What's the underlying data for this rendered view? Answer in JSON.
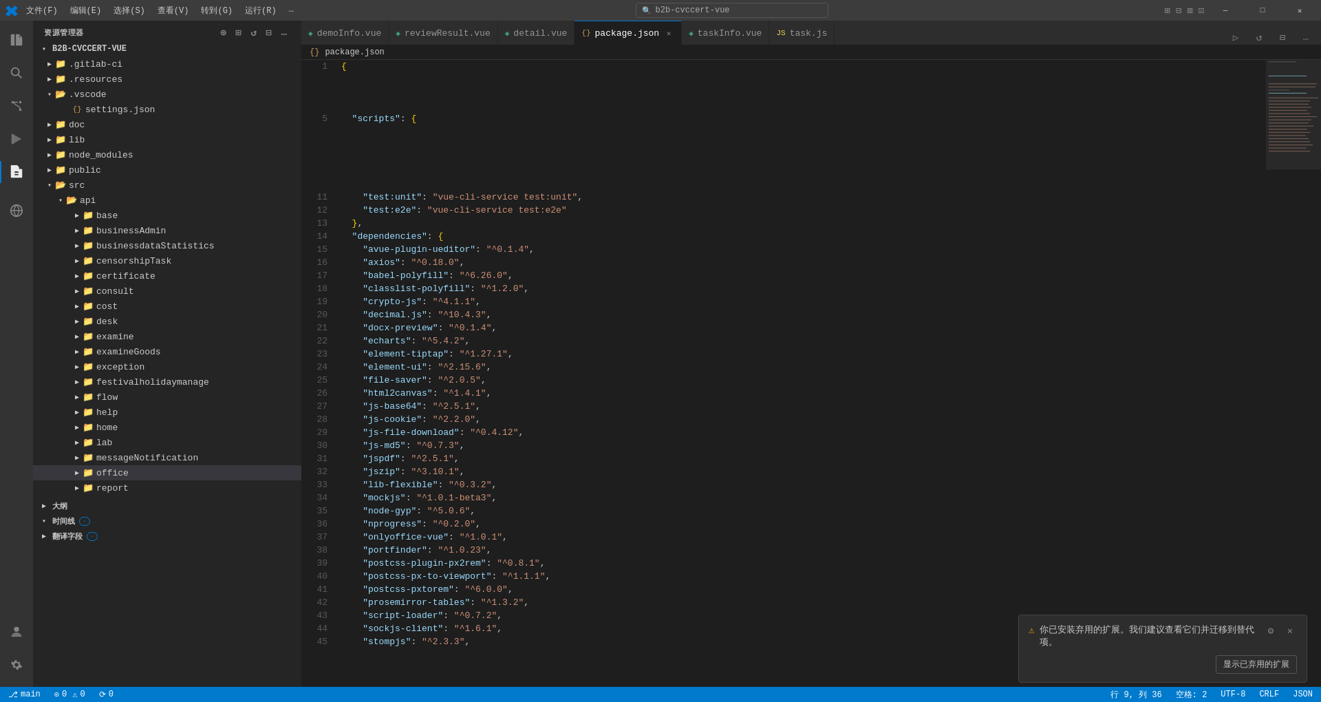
{
  "titlebar": {
    "menus": [
      "文件(F)",
      "编辑(E)",
      "选择(S)",
      "查看(V)",
      "转到(G)",
      "运行(R)",
      "…"
    ],
    "search_placeholder": "b2b-cvccert-vue",
    "window_buttons": [
      "—",
      "□",
      "✕"
    ]
  },
  "activity_bar": {
    "items": [
      {
        "name": "explorer",
        "icon": "⎗",
        "active": false
      },
      {
        "name": "search",
        "icon": "🔍",
        "active": false
      },
      {
        "name": "source-control",
        "icon": "⎇",
        "active": false
      },
      {
        "name": "run-debug",
        "icon": "▷",
        "active": false
      },
      {
        "name": "extensions",
        "icon": "⧉",
        "active": true
      },
      {
        "name": "remote-explorer",
        "icon": "⟳",
        "active": false
      },
      {
        "name": "account",
        "icon": "👤",
        "active": false
      },
      {
        "name": "settings",
        "icon": "⚙",
        "active": false
      }
    ]
  },
  "sidebar": {
    "title": "资源管理器",
    "root": "B2B-CVCCERT-VUE",
    "tree": [
      {
        "level": 1,
        "type": "folder",
        "label": ".gitlab-ci",
        "expanded": false
      },
      {
        "level": 1,
        "type": "folder",
        "label": ".resources",
        "expanded": false
      },
      {
        "level": 1,
        "type": "folder",
        "label": ".vscode",
        "expanded": true
      },
      {
        "level": 2,
        "type": "file",
        "label": "settings.json",
        "icon": "{}"
      },
      {
        "level": 1,
        "type": "folder",
        "label": "doc",
        "expanded": false
      },
      {
        "level": 1,
        "type": "folder",
        "label": "lib",
        "expanded": false
      },
      {
        "level": 1,
        "type": "folder",
        "label": "node_modules",
        "expanded": false
      },
      {
        "level": 1,
        "type": "folder",
        "label": "public",
        "expanded": false
      },
      {
        "level": 1,
        "type": "folder",
        "label": "src",
        "expanded": true
      },
      {
        "level": 2,
        "type": "folder",
        "label": "api",
        "expanded": true
      },
      {
        "level": 3,
        "type": "folder",
        "label": "base",
        "expanded": false
      },
      {
        "level": 3,
        "type": "folder",
        "label": "businessAdmin",
        "expanded": false
      },
      {
        "level": 3,
        "type": "folder",
        "label": "businessdataStatistics",
        "expanded": false
      },
      {
        "level": 3,
        "type": "folder",
        "label": "censorshipTask",
        "expanded": false
      },
      {
        "level": 3,
        "type": "folder",
        "label": "certificate",
        "expanded": false
      },
      {
        "level": 3,
        "type": "folder",
        "label": "consult",
        "expanded": false
      },
      {
        "level": 3,
        "type": "folder",
        "label": "cost",
        "expanded": false
      },
      {
        "level": 3,
        "type": "folder",
        "label": "desk",
        "expanded": false
      },
      {
        "level": 3,
        "type": "folder",
        "label": "examine",
        "expanded": false
      },
      {
        "level": 3,
        "type": "folder",
        "label": "examineGoods",
        "expanded": false
      },
      {
        "level": 3,
        "type": "folder",
        "label": "exception",
        "expanded": false
      },
      {
        "level": 3,
        "type": "folder",
        "label": "festivalholidaymanage",
        "expanded": false
      },
      {
        "level": 3,
        "type": "folder",
        "label": "flow",
        "expanded": false
      },
      {
        "level": 3,
        "type": "folder",
        "label": "help",
        "expanded": false
      },
      {
        "level": 3,
        "type": "folder",
        "label": "home",
        "expanded": false
      },
      {
        "level": 3,
        "type": "folder",
        "label": "lab",
        "expanded": false
      },
      {
        "level": 3,
        "type": "folder",
        "label": "messageNotification",
        "expanded": false
      },
      {
        "level": 3,
        "type": "folder",
        "label": "office",
        "expanded": false,
        "highlighted": true
      },
      {
        "level": 3,
        "type": "folder",
        "label": "report",
        "expanded": false
      }
    ],
    "bottom_items": [
      {
        "label": "大纲",
        "expanded": true
      },
      {
        "label": "时间线",
        "expanded": true
      },
      {
        "label": "翻译字段",
        "expanded": true
      }
    ]
  },
  "tabs": [
    {
      "label": "demoInfo.vue",
      "type": "vue",
      "active": false,
      "dirty": false
    },
    {
      "label": "reviewResult.vue",
      "type": "vue",
      "active": false,
      "dirty": false
    },
    {
      "label": "detail.vue",
      "type": "vue",
      "active": false,
      "dirty": false
    },
    {
      "label": "package.json",
      "type": "json",
      "active": true,
      "dirty": false
    },
    {
      "label": "taskInfo.vue",
      "type": "vue",
      "active": false,
      "dirty": false
    },
    {
      "label": "task.js",
      "type": "js",
      "active": false,
      "dirty": false
    }
  ],
  "breadcrumb": {
    "parts": [
      "package.json"
    ]
  },
  "editor": {
    "filename": "package.json",
    "lines": [
      {
        "num": 1,
        "content": "{"
      },
      {
        "num": 5,
        "content": "  \"scripts\": {"
      },
      {
        "num": 11,
        "content": "    \"test:unit\": \"vue-cli-service test:unit\","
      },
      {
        "num": 12,
        "content": "    \"test:e2e\": \"vue-cli-service test:e2e\""
      },
      {
        "num": 13,
        "content": "  },"
      },
      {
        "num": 14,
        "content": "  \"dependencies\": {"
      },
      {
        "num": 15,
        "content": "    \"avue-plugin-ueditor\": \"^0.1.4\","
      },
      {
        "num": 16,
        "content": "    \"axios\": \"^0.18.0\","
      },
      {
        "num": 17,
        "content": "    \"babel-polyfill\": \"^6.26.0\","
      },
      {
        "num": 18,
        "content": "    \"classlist-polyfill\": \"^1.2.0\","
      },
      {
        "num": 19,
        "content": "    \"crypto-js\": \"^4.1.1\","
      },
      {
        "num": 20,
        "content": "    \"decimal.js\": \"^10.4.3\","
      },
      {
        "num": 21,
        "content": "    \"docx-preview\": \"^0.1.4\","
      },
      {
        "num": 22,
        "content": "    \"echarts\": \"^5.4.2\","
      },
      {
        "num": 23,
        "content": "    \"element-tiptap\": \"^1.27.1\","
      },
      {
        "num": 24,
        "content": "    \"element-ui\": \"^2.15.6\","
      },
      {
        "num": 25,
        "content": "    \"file-saver\": \"^2.0.5\","
      },
      {
        "num": 26,
        "content": "    \"html2canvas\": \"^1.4.1\","
      },
      {
        "num": 27,
        "content": "    \"js-base64\": \"^2.5.1\","
      },
      {
        "num": 28,
        "content": "    \"js-cookie\": \"^2.2.0\","
      },
      {
        "num": 29,
        "content": "    \"js-file-download\": \"^0.4.12\","
      },
      {
        "num": 30,
        "content": "    \"js-md5\": \"^0.7.3\","
      },
      {
        "num": 31,
        "content": "    \"jspdf\": \"^2.5.1\","
      },
      {
        "num": 32,
        "content": "    \"jszip\": \"^3.10.1\","
      },
      {
        "num": 33,
        "content": "    \"lib-flexible\": \"^0.3.2\","
      },
      {
        "num": 34,
        "content": "    \"mockjs\": \"^1.0.1-beta3\","
      },
      {
        "num": 35,
        "content": "    \"node-gyp\": \"^5.0.6\","
      },
      {
        "num": 36,
        "content": "    \"nprogress\": \"^0.2.0\","
      },
      {
        "num": 37,
        "content": "    \"onlyoffice-vue\": \"^1.0.1\","
      },
      {
        "num": 38,
        "content": "    \"portfinder\": \"^1.0.23\","
      },
      {
        "num": 39,
        "content": "    \"postcss-plugin-px2rem\": \"^0.8.1\","
      },
      {
        "num": 40,
        "content": "    \"postcss-px-to-viewport\": \"^1.1.1\","
      },
      {
        "num": 41,
        "content": "    \"postcss-pxtorem\": \"^6.0.0\","
      },
      {
        "num": 42,
        "content": "    \"prosemirror-tables\": \"^1.3.2\","
      },
      {
        "num": 43,
        "content": "    \"script-loader\": \"^0.7.2\","
      },
      {
        "num": 44,
        "content": "    \"sockjs-client\": \"^1.6.1\","
      },
      {
        "num": 45,
        "content": "    \"stompjs\": \"^2.3.3\","
      }
    ]
  },
  "notification": {
    "icon": "⚠",
    "text": "你已安装弃用的扩展。我们建议查看它们并迁移到替代项。",
    "actions": [
      "显示已弃用的扩展"
    ],
    "gear_label": "⚙",
    "close_label": "✕"
  },
  "status_bar": {
    "left": [
      {
        "icon": "⎇",
        "text": "main"
      },
      {
        "icon": "⊙",
        "text": "0"
      },
      {
        "icon": "⚠",
        "text": "0"
      }
    ],
    "right": [
      {
        "text": "行 9, 列 36"
      },
      {
        "text": "空格: 2"
      },
      {
        "text": "UTF-8"
      },
      {
        "text": "CRLF"
      },
      {
        "text": "JSON"
      }
    ]
  }
}
